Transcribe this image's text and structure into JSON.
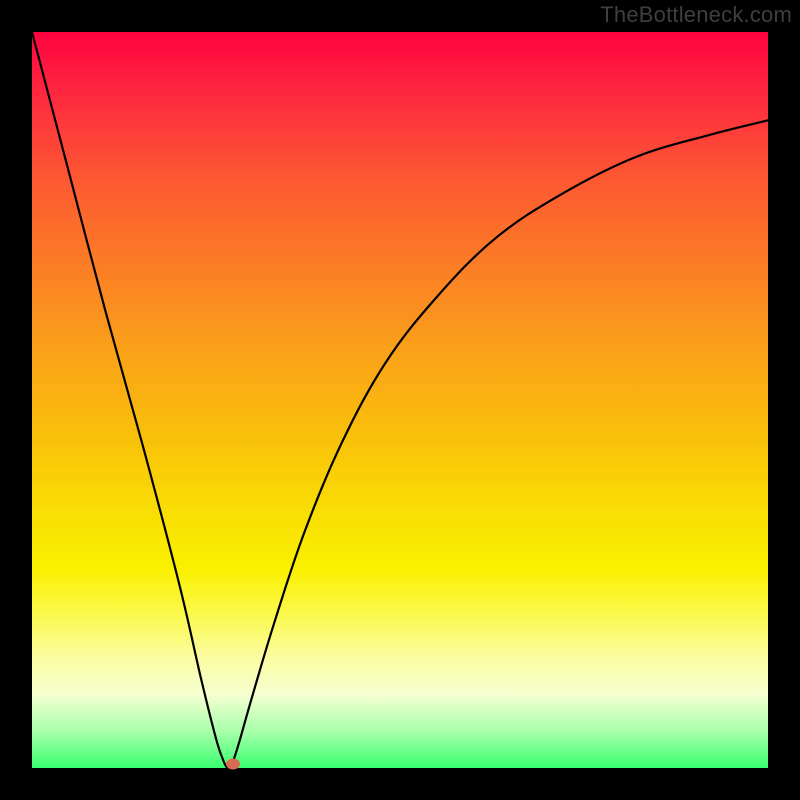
{
  "watermark": "TheBottleneck.com",
  "chart_data": {
    "type": "line",
    "title": "",
    "xlabel": "",
    "ylabel": "",
    "xlim": [
      0,
      100
    ],
    "ylim": [
      0,
      100
    ],
    "series": [
      {
        "name": "left-branch",
        "x": [
          0,
          5,
          10,
          15,
          20,
          23,
          25,
          26,
          26.5
        ],
        "values": [
          100,
          81,
          62,
          44,
          25,
          12,
          4,
          1,
          0
        ]
      },
      {
        "name": "right-branch",
        "x": [
          27,
          28,
          30,
          33,
          37,
          42,
          48,
          55,
          63,
          72,
          82,
          92,
          100
        ],
        "values": [
          0,
          3,
          10,
          20,
          32,
          44,
          55,
          64,
          72,
          78,
          83,
          86,
          88
        ]
      }
    ],
    "marker": {
      "x": 27.3,
      "y": 0.5,
      "color": "#d86b51"
    },
    "gradient_stops": [
      {
        "pos": 0,
        "color": "#fe0340"
      },
      {
        "pos": 50,
        "color": "#f9c309"
      },
      {
        "pos": 100,
        "color": "#39ff6f"
      }
    ]
  }
}
